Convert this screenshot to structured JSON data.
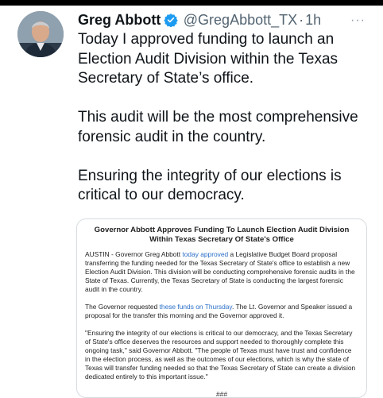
{
  "tweet": {
    "author_name": "Greg Abbott",
    "handle": "@GregAbbott_TX",
    "separator": "·",
    "time": "1h",
    "more_label": "···",
    "paragraphs": [
      "Today I approved funding to launch an Election Audit Division within the Texas Secretary of State’s office.",
      "This audit will be the most comprehensive forensic audit in the country.",
      "Ensuring the integrity of our elections is critical to our democracy."
    ]
  },
  "card": {
    "title": "Governor Abbott Approves Funding To Launch Election Audit Division Within Texas Secretary Of State's Office",
    "p1_a": "AUSTIN - Governor Greg Abbott ",
    "p1_link": "today approved",
    "p1_b": " a Legislative Budget Board proposal transferring the funding needed for the Texas Secretary of State's office to establish a new Election Audit Division. This division will be conducting comprehensive forensic audits in the State of Texas. Currently, the Texas Secretary of State is conducting the largest forensic audit in the country.",
    "p2_a": "The Governor requested ",
    "p2_link": "these funds on Thursday",
    "p2_b": ". The Lt. Governor and Speaker issued a proposal for the transfer this morning and the Governor approved it.",
    "p3": "\"Ensuring the integrity of our elections is critical to our democracy, and the Texas Secretary of State's office deserves the resources and support needed to thoroughly complete this ongoing task,\" said Governor Abbott. \"The people of Texas must have trust and confidence in the election process, as well as the outcomes of our elections, which is why the state of Texas will transfer funding needed so that the Texas Secretary of State can create a division dedicated entirely to this important issue.\"",
    "end_mark": "###"
  },
  "colors": {
    "verified_badge": "#1d9bf0",
    "handle": "#536471",
    "link": "#2a6fc9"
  }
}
